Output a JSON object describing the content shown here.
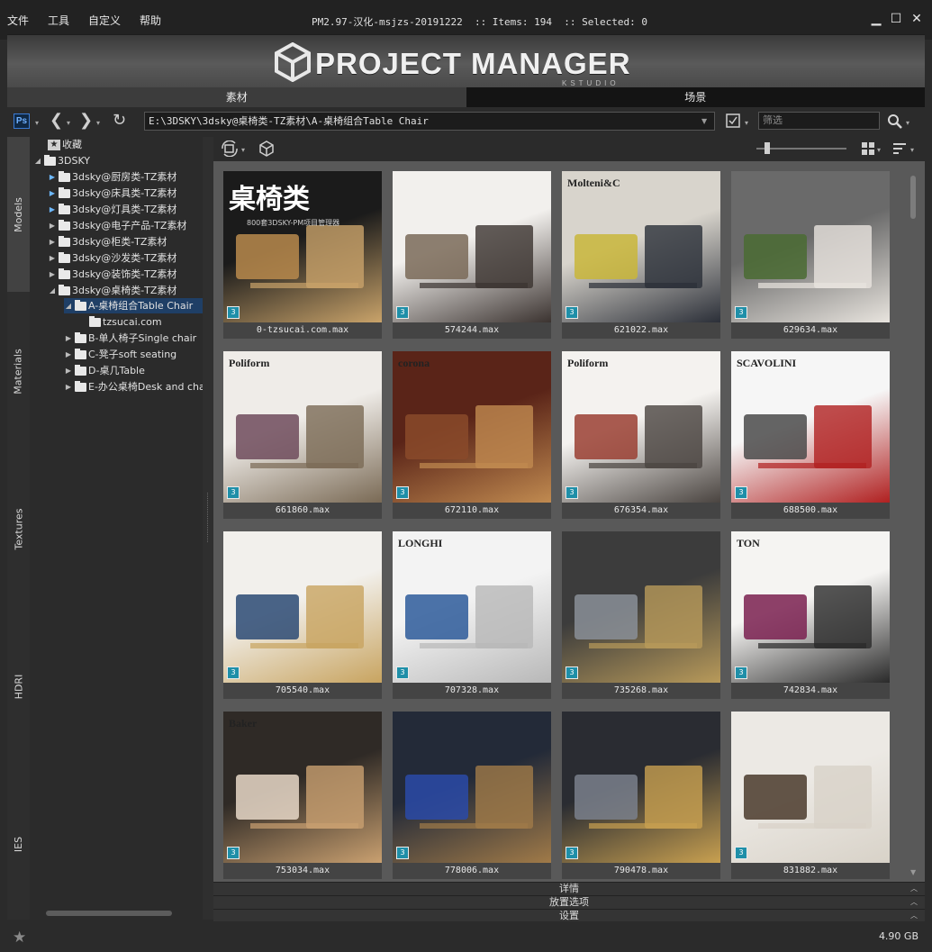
{
  "menu": [
    "文件",
    "工具",
    "自定义",
    "帮助"
  ],
  "window_title": "PM2.97-汉化-msjzs-20191222  :: Items: 194  :: Selected: 0",
  "window_controls": {
    "minimize": "▁",
    "maximize": "☐",
    "close": "✕"
  },
  "banner": {
    "logo_text": "PROJECT MANAGER",
    "logo_sub": "KSTUDIO"
  },
  "tabs": [
    "素材",
    "场景"
  ],
  "pathbar": {
    "ps_label": "Ps",
    "path": "E:\\3DSKY\\3dsky@桌椅类-TZ素材\\A-桌椅组合Table Chair",
    "filter_placeholder": "筛选"
  },
  "vertical_tabs": [
    "Models",
    "Materials",
    "Textures",
    "HDRI",
    "IES"
  ],
  "tree": {
    "favorites": "收藏",
    "root": "3DSKY",
    "items": [
      "3dsky@厨房类-TZ素材",
      "3dsky@床具类-TZ素材",
      "3dsky@灯具类-TZ素材",
      "3dsky@电子产品-TZ素材",
      "3dsky@柜类-TZ素材",
      "3dsky@沙发类-TZ素材",
      "3dsky@装饰类-TZ素材",
      "3dsky@桌椅类-TZ素材"
    ],
    "selected": "A-桌椅组合Table Chair",
    "child": "tzsucai.com",
    "siblings": [
      "B-单人椅子Single chair",
      "C-凳子soft seating",
      "D-桌几Table",
      "E-办公桌椅Desk and chair"
    ]
  },
  "grid": {
    "items": [
      {
        "label": "0-tzsucai.com.max",
        "thumb_text": "桌椅类",
        "thumb_sub": "800套3DSKY-PM项目管理器",
        "colors": [
          "#1b1b1b",
          "#b88a4c",
          "#c9a36a"
        ]
      },
      {
        "label": "574244.max",
        "colors": [
          "#f2f0ed",
          "#7a6a58",
          "#3b3330"
        ]
      },
      {
        "label": "621022.max",
        "thumb_text": "Molteni&C",
        "colors": [
          "#d8d4cc",
          "#c9b63a",
          "#2b2f38"
        ]
      },
      {
        "label": "629634.max",
        "colors": [
          "#6a6a6a",
          "#4a6b32",
          "#e8e4de"
        ]
      },
      {
        "label": "661860.max",
        "thumb_text": "Poliform",
        "colors": [
          "#efece8",
          "#6e4b5c",
          "#7a6a55"
        ]
      },
      {
        "label": "672110.max",
        "thumb_text": "corona",
        "colors": [
          "#5a2418",
          "#8a4a2a",
          "#c08a50"
        ]
      },
      {
        "label": "676354.max",
        "thumb_text": "Poliform",
        "colors": [
          "#f4f2ef",
          "#9a3f32",
          "#4a4440"
        ]
      },
      {
        "label": "688500.max",
        "thumb_text": "SCAVOLINI",
        "colors": [
          "#f6f6f6",
          "#4a4a4a",
          "#b02020"
        ]
      },
      {
        "label": "705540.max",
        "colors": [
          "#f2f0ec",
          "#2c4a74",
          "#c8a460"
        ]
      },
      {
        "label": "707328.max",
        "thumb_text": "LONGHI",
        "colors": [
          "#f3f3f3",
          "#2d5a9a",
          "#b8b8b8"
        ]
      },
      {
        "label": "735268.max",
        "colors": [
          "#3c3c3c",
          "#8a8f98",
          "#b89a5a"
        ]
      },
      {
        "label": "742834.max",
        "thumb_text": "TON",
        "colors": [
          "#f5f4f2",
          "#7a2050",
          "#2a2a2a"
        ]
      },
      {
        "label": "753034.max",
        "thumb_text": "Baker",
        "colors": [
          "#2f2a26",
          "#e8d8c8",
          "#c9a070"
        ]
      },
      {
        "label": "778006.max",
        "colors": [
          "#232a38",
          "#2a4aa8",
          "#a07a48"
        ]
      },
      {
        "label": "790478.max",
        "colors": [
          "#2a2c32",
          "#7a808c",
          "#c8a050"
        ]
      },
      {
        "label": "831882.max",
        "colors": [
          "#ece9e4",
          "#4a3a2c",
          "#d8d2c8"
        ]
      }
    ]
  },
  "sections": [
    "详情",
    "放置选项",
    "设置"
  ],
  "status": {
    "disk_size": "4.90 GB"
  }
}
